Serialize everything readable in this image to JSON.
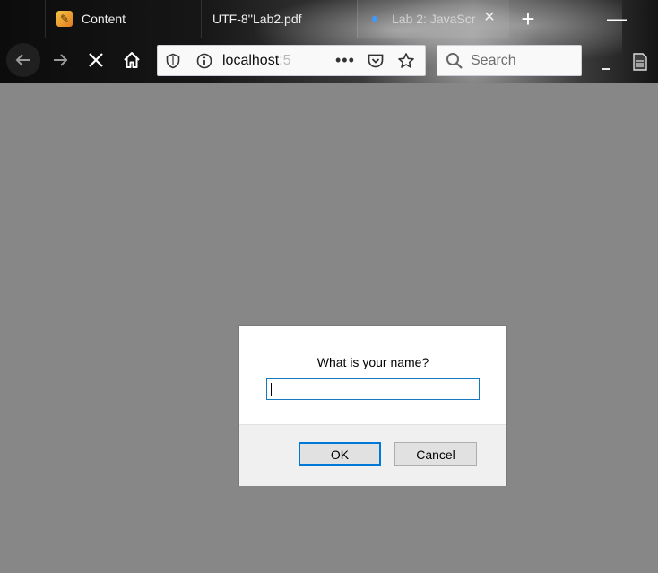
{
  "browser": {
    "tabs": [
      {
        "label": "Content",
        "icon": "pencil-icon"
      },
      {
        "label": "UTF-8''Lab2.pdf",
        "icon": ""
      },
      {
        "label": "Lab 2: JavaScr",
        "icon": "loading-dot-icon",
        "active": true
      }
    ],
    "new_tab_symbol": "+",
    "minimize_symbol": "—",
    "tab_close_symbol": "✕",
    "url": {
      "host": "localhost",
      "host_fade": ":5"
    },
    "url_more_symbol": "•••",
    "search": {
      "placeholder": "Search"
    }
  },
  "dialog": {
    "message": "What is your name?",
    "input_value": "",
    "ok_label": "OK",
    "cancel_label": "Cancel"
  },
  "colors": {
    "page_background": "#878787",
    "accent": "#0078d7",
    "input_border": "#1479bf"
  }
}
